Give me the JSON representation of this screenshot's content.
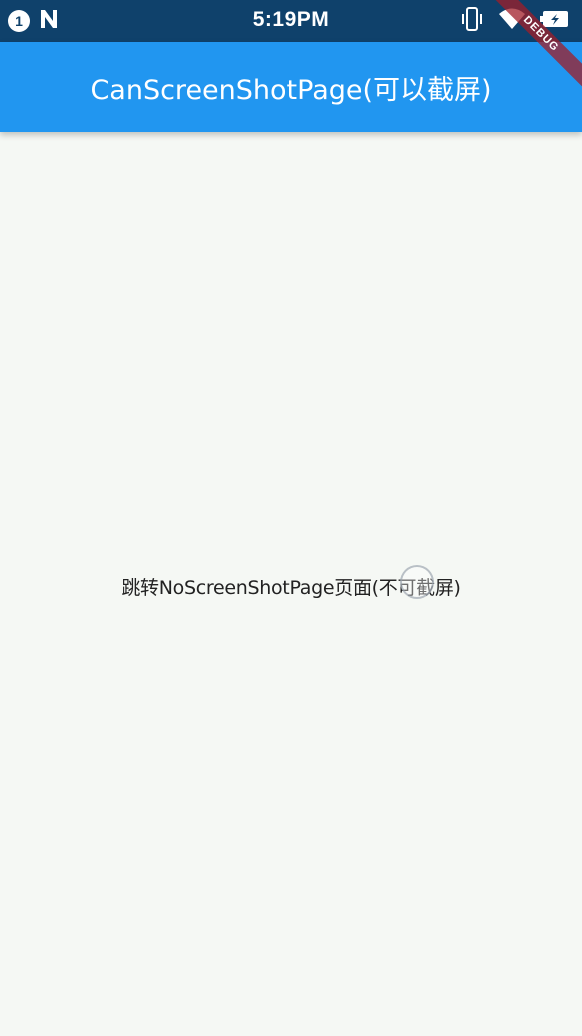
{
  "status_bar": {
    "notification_count": "1",
    "time": "5:19PM",
    "icons": [
      "notification-badge-icon",
      "n-app-icon",
      "vibrate-icon",
      "wifi-icon",
      "battery-charging-icon"
    ]
  },
  "debug_banner": {
    "label": "DEBUG"
  },
  "app_bar": {
    "title": "CanScreenShotPage(可以截屏)"
  },
  "main": {
    "nav_button_label": "跳转NoScreenShotPage页面(不可截屏)"
  },
  "colors": {
    "status_bar": "#0f416b",
    "app_bar": "#2196f0",
    "background": "#f5f8f4",
    "text": "#222222"
  }
}
